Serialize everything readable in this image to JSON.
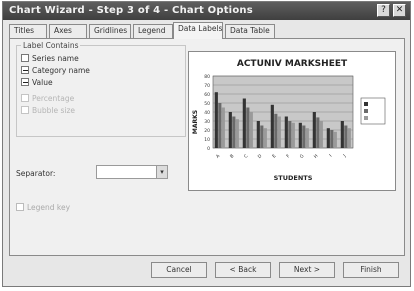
{
  "window": {
    "title": "Chart Wizard - Step 3 of 4 - Chart Options",
    "help_label": "?",
    "close_label": "✕"
  },
  "tabs": [
    {
      "label": "Titles"
    },
    {
      "label": "Axes"
    },
    {
      "label": "Gridlines"
    },
    {
      "label": "Legend"
    },
    {
      "label": "Data Labels"
    },
    {
      "label": "Data Table"
    }
  ],
  "label_contains": {
    "title": "Label Contains",
    "options": [
      {
        "label": "Series name",
        "checked": false
      },
      {
        "label": "Category name",
        "checked": true
      },
      {
        "label": "Value",
        "checked": true
      },
      {
        "label": "Percentage",
        "checked": false
      },
      {
        "label": "Bubble size",
        "checked": false
      }
    ]
  },
  "separator": {
    "label": "Separator:",
    "value": ""
  },
  "legend_key": {
    "label": "Legend key"
  },
  "chart_data": {
    "type": "bar",
    "title": "ACTUNIV MARKSHEET",
    "xlabel": "STUDENTS",
    "ylabel": "MARKS",
    "categories": [
      "A",
      "B",
      "C",
      "D",
      "E",
      "F",
      "G",
      "H",
      "I",
      "J"
    ],
    "series": [
      {
        "values": [
          62,
          40,
          55,
          30,
          48,
          35,
          28,
          40,
          22,
          30
        ]
      },
      {
        "values": [
          50,
          35,
          45,
          25,
          38,
          30,
          25,
          34,
          20,
          25
        ]
      },
      {
        "values": [
          45,
          32,
          40,
          22,
          35,
          28,
          22,
          30,
          18,
          22
        ]
      }
    ],
    "ylim": [
      0,
      80
    ],
    "yticks": [
      0,
      10,
      20,
      30,
      40,
      50,
      60,
      70,
      80
    ],
    "legend_position": "right"
  },
  "buttons": {
    "cancel": "Cancel",
    "back": "< Back",
    "next": "Next >",
    "finish": "Finish"
  },
  "colors": {
    "titlebar": "#4a4a4a",
    "bar_dark": "#333333",
    "bar_mid": "#6a6a6a",
    "bar_light": "#9a9a9a",
    "plot_bg": "#c8c8c8"
  }
}
